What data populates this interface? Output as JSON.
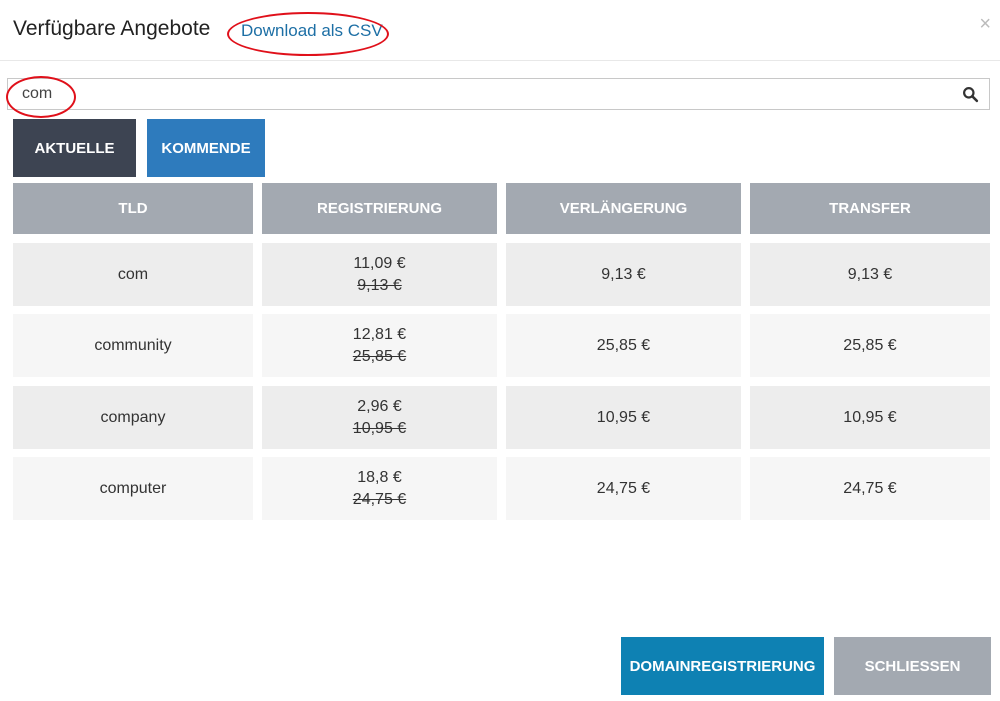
{
  "modal": {
    "title": "Verfügbare Angebote",
    "csv_link": "Download als CSV",
    "close": "×"
  },
  "search": {
    "value": "com",
    "icon": "search-icon"
  },
  "tabs": [
    {
      "label": "AKTUELLE",
      "active": true
    },
    {
      "label": "KOMMENDE",
      "active": false
    }
  ],
  "table": {
    "headers": [
      "TLD",
      "REGISTRIERUNG",
      "VERLÄNGERUNG",
      "TRANSFER"
    ],
    "rows": [
      {
        "tld": "com",
        "registration": "11,09 €",
        "registration_old": "9,13 €",
        "renewal": "9,13 €",
        "transfer": "9,13 €"
      },
      {
        "tld": "community",
        "registration": "12,81 €",
        "registration_old": "25,85 €",
        "renewal": "25,85 €",
        "transfer": "25,85 €"
      },
      {
        "tld": "company",
        "registration": "2,96 €",
        "registration_old": "10,95 €",
        "renewal": "10,95 €",
        "transfer": "10,95 €"
      },
      {
        "tld": "computer",
        "registration": "18,8 €",
        "registration_old": "24,75 €",
        "renewal": "24,75 €",
        "transfer": "24,75 €"
      }
    ]
  },
  "footer": {
    "primary_label": "DOMAINREGISTRIERUNG",
    "secondary_label": "SCHLIESSEN"
  },
  "colors": {
    "tab_active": "#3d4452",
    "tab_inactive": "#2e7bbd",
    "header_bg": "#a3a9b1",
    "row_odd": "#ededed",
    "row_even": "#f6f6f6",
    "primary_button": "#0e81b3",
    "annotation": "#e0101a"
  }
}
